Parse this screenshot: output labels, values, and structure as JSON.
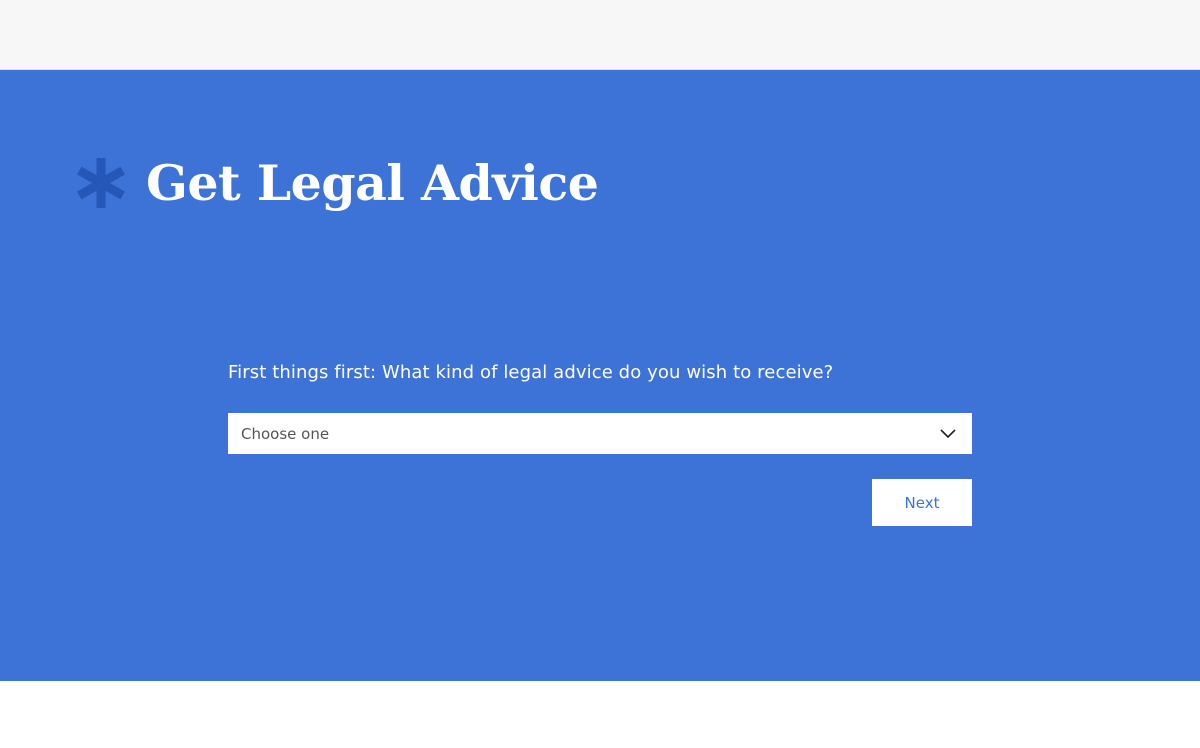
{
  "header": {},
  "hero": {
    "title": "Get Legal Advice",
    "icon": "asterisk-icon",
    "question": "First things first: What kind of legal advice do you wish to receive?",
    "select": {
      "selected": "Choose one",
      "icon": "chevron-down-icon"
    },
    "next_label": "Next"
  },
  "colors": {
    "hero_background": "#3d73d6",
    "asterisk": "#2557b8",
    "top_bar": "#f7f7f7",
    "button_text": "#3d73d6"
  }
}
